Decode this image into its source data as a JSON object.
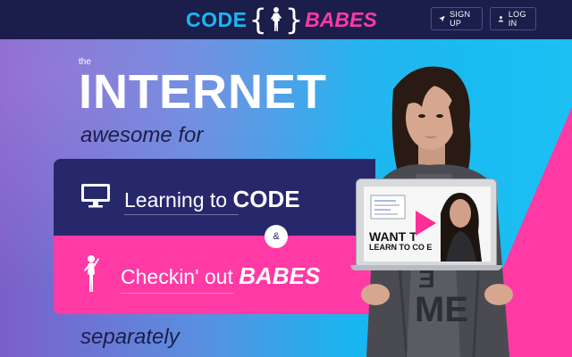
{
  "brand": {
    "left_word": "CODE",
    "right_word": "BABES",
    "open_brace": "{",
    "close_brace": "}"
  },
  "nav": {
    "signup_label": "SIGN UP",
    "login_label": "LOG IN",
    "signup_icon": "rocket-icon",
    "login_icon": "user-icon"
  },
  "hero": {
    "the": "the",
    "headline": "INTERNET",
    "awesome": "awesome for",
    "separately": "separately"
  },
  "panels": {
    "code_prefix": "Learning to ",
    "code_word": "CODE",
    "amp": "&",
    "babes_prefix": "Checkin' out ",
    "babes_word": "BABES",
    "code_icon": "monitor-icon",
    "babes_icon": "woman-silhouette-icon"
  },
  "video": {
    "line1": "WANT T",
    "line2": "LEARN TO CO E",
    "play_icon": "play-icon"
  },
  "colors": {
    "navy": "#1b1e4b",
    "blue": "#18b9f2",
    "pink": "#ff3aa5",
    "panel_navy": "#27286c"
  }
}
